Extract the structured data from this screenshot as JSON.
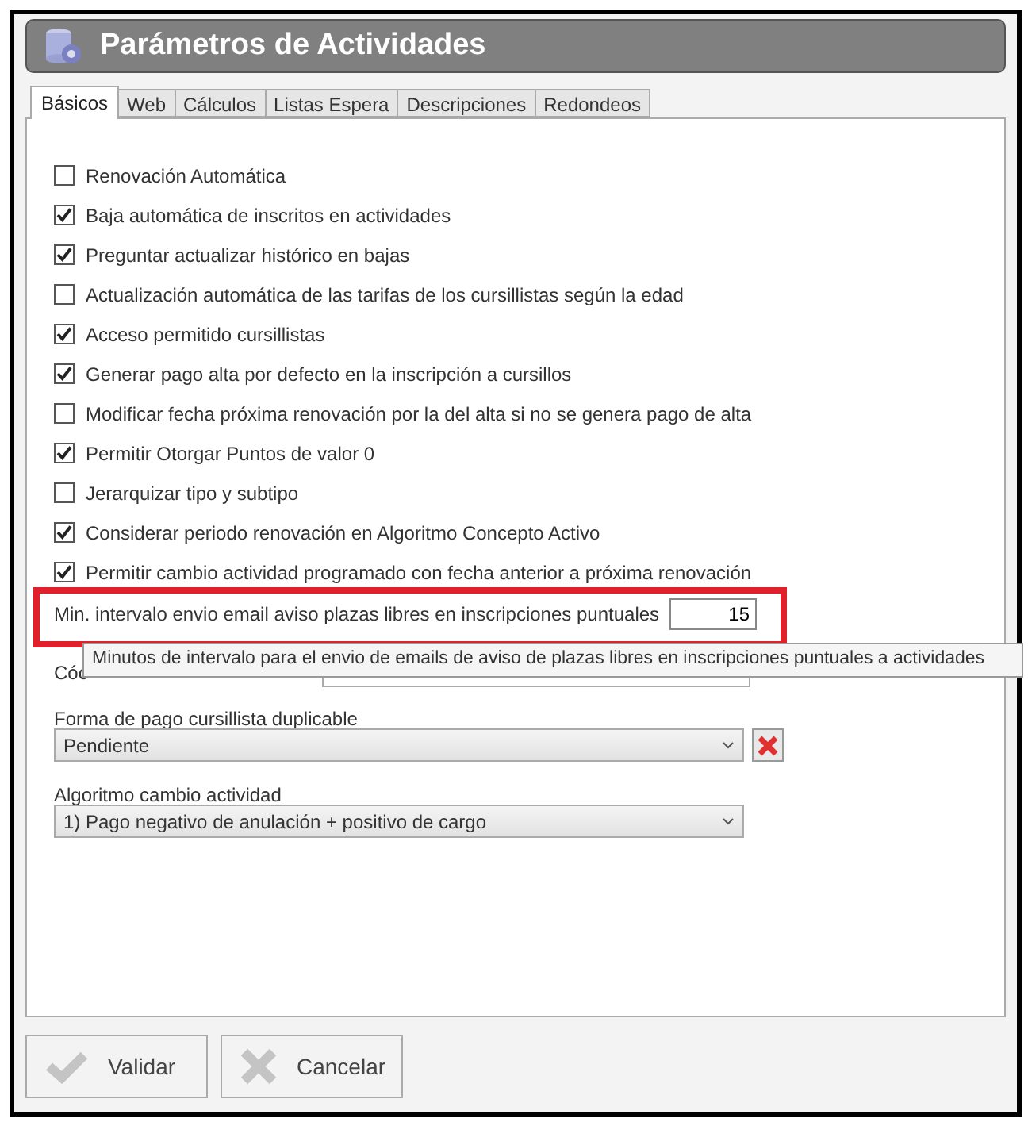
{
  "window": {
    "title": "Parámetros de Actividades"
  },
  "tabs": [
    {
      "label": "Básicos",
      "selected": true
    },
    {
      "label": "Web",
      "selected": false
    },
    {
      "label": "Cálculos",
      "selected": false
    },
    {
      "label": "Listas Espera",
      "selected": false
    },
    {
      "label": "Descripciones",
      "selected": false
    },
    {
      "label": "Redondeos",
      "selected": false
    }
  ],
  "options": [
    {
      "label": "Renovación Automática",
      "checked": false
    },
    {
      "label": "Baja automática de inscritos en actividades",
      "checked": true
    },
    {
      "label": "Preguntar actualizar histórico en bajas",
      "checked": true
    },
    {
      "label": "Actualización automática de las tarifas de los cursillistas según la edad",
      "checked": false
    },
    {
      "label": "Acceso permitido cursillistas",
      "checked": true
    },
    {
      "label": "Generar pago alta por defecto en la inscripción a cursillos",
      "checked": true
    },
    {
      "label": "Modificar fecha próxima renovación por la del alta si no se genera pago de alta",
      "checked": false
    },
    {
      "label": "Permitir Otorgar Puntos de valor 0",
      "checked": true
    },
    {
      "label": "Jerarquizar tipo y subtipo",
      "checked": false
    },
    {
      "label": "Considerar periodo renovación en Algoritmo Concepto Activo",
      "checked": true
    },
    {
      "label": "Permitir cambio actividad programado con fecha anterior a próxima renovación",
      "checked": true
    }
  ],
  "interval_field": {
    "label": "Min. intervalo envio email aviso plazas libres en inscripciones puntuales",
    "value": "15"
  },
  "tooltip": "Minutos de intervalo para el envio de emails de aviso de plazas libres en inscripciones puntuales a actividades",
  "code_field": {
    "label": "Cóc"
  },
  "payment_field": {
    "label": "Forma de pago cursillista duplicable",
    "value": "Pendiente"
  },
  "algorithm_field": {
    "label": "Algoritmo cambio actividad",
    "value": "1) Pago negativo de anulación + positivo de cargo"
  },
  "buttons": [
    {
      "label": "Validar",
      "kind": "check"
    },
    {
      "label": "Cancelar",
      "kind": "cross"
    }
  ]
}
